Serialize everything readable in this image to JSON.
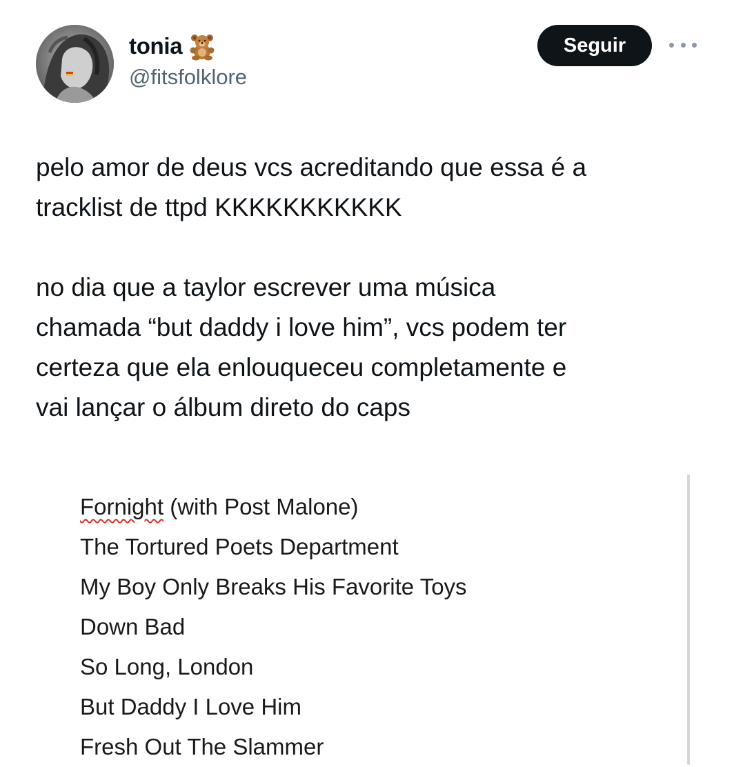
{
  "author": {
    "display_name": "tonia",
    "emoji_icon": "teddy-bear-icon",
    "handle": "@fitsfolklore",
    "avatar": "profile-photo"
  },
  "follow_button": {
    "label": "Seguir"
  },
  "more_menu": {
    "icon": "more-horizontal-icon"
  },
  "tweet": {
    "paragraphs": [
      [
        "pelo amor de deus vcs acreditando que essa é a",
        "tracklist de ttpd KKKKKKKKKKK"
      ],
      [
        "no dia que a taylor escrever uma música",
        "chamada “but daddy i love him”, vcs podem ter",
        "certeza que ela enlouqueceu completamente e",
        "vai lançar o álbum direto do caps"
      ]
    ]
  },
  "attached_image": {
    "tracks": [
      {
        "title_main": "Fornight",
        "title_rest": " (with Post Malone)"
      },
      {
        "title_main": "The Tortured Poets Department",
        "title_rest": ""
      },
      {
        "title_main": "My Boy Only Breaks His Favorite Toys",
        "title_rest": ""
      },
      {
        "title_main": "Down Bad",
        "title_rest": ""
      },
      {
        "title_main": "So Long, London",
        "title_rest": ""
      },
      {
        "title_main": "But Daddy I Love Him",
        "title_rest": ""
      },
      {
        "title_main": "Fresh Out The Slammer",
        "title_rest": ""
      }
    ]
  },
  "colors": {
    "text": "#0f1419",
    "secondary": "#536471",
    "button_bg": "#0f1419",
    "button_text": "#ffffff",
    "spellcheck": "#d93025"
  }
}
